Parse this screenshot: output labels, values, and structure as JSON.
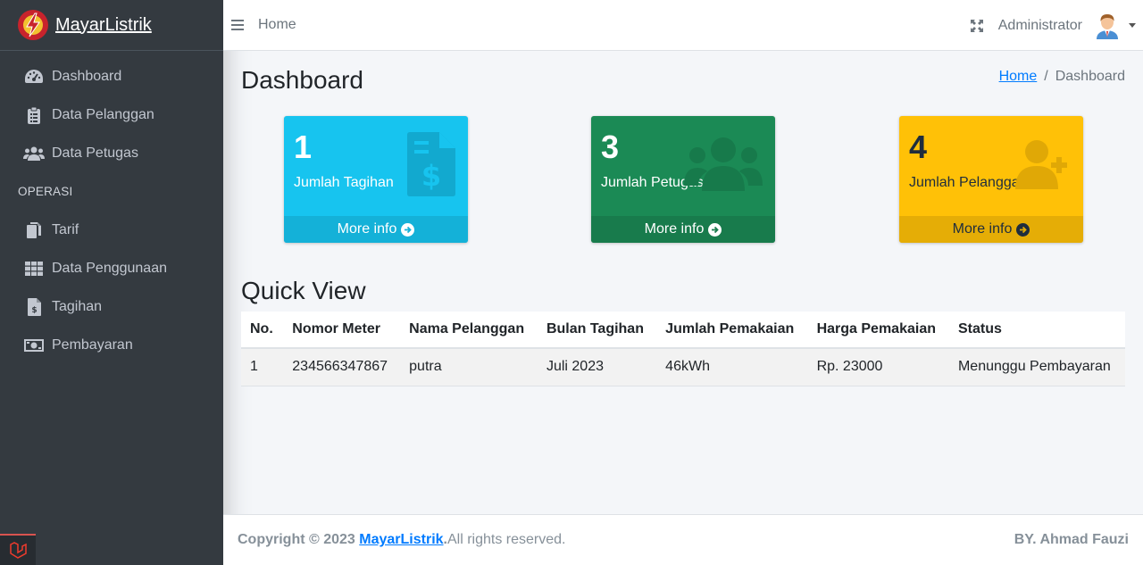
{
  "brand": {
    "name": "MayarListrik"
  },
  "sidebar": {
    "items": [
      {
        "label": "Dashboard",
        "icon": "tachometer-icon"
      },
      {
        "label": "Data Pelanggan",
        "icon": "clipboard-icon"
      },
      {
        "label": "Data Petugas",
        "icon": "users-icon"
      }
    ],
    "section_header": "OPERASI",
    "operasi_items": [
      {
        "label": "Tarif",
        "icon": "copy-icon"
      },
      {
        "label": "Data Penggunaan",
        "icon": "grid-icon"
      },
      {
        "label": "Tagihan",
        "icon": "invoice-icon"
      },
      {
        "label": "Pembayaran",
        "icon": "money-bill-icon"
      }
    ]
  },
  "topbar": {
    "home_label": "Home",
    "user_name": "Administrator"
  },
  "page": {
    "title": "Dashboard",
    "breadcrumb": {
      "home": "Home",
      "separator": "/",
      "current": "Dashboard"
    }
  },
  "info_boxes": [
    {
      "number": "1",
      "label": "Jumlah Tagihan",
      "more": "More info",
      "color": "#17c4ef"
    },
    {
      "number": "3",
      "label": "Jumlah Petugas",
      "more": "More info",
      "color": "#1b8a55"
    },
    {
      "number": "4",
      "label": "Jumlah Pelanggan",
      "more": "More info",
      "color": "#ffc107"
    }
  ],
  "quick_view": {
    "title": "Quick View",
    "columns": [
      "No.",
      "Nomor Meter",
      "Nama Pelanggan",
      "Bulan Tagihan",
      "Jumlah Pemakaian",
      "Harga Pemakaian",
      "Status"
    ],
    "rows": [
      [
        "1",
        "234566347867",
        "putra",
        "Juli 2023",
        "46kWh",
        "Rp. 23000",
        "Menunggu Pembayaran"
      ]
    ]
  },
  "footer": {
    "copyright_prefix": "Copyright © 2023",
    "brand_link": "MayarListrik",
    "suffix": ". All rights reserved.",
    "author": "BY. Ahmad Fauzi"
  }
}
